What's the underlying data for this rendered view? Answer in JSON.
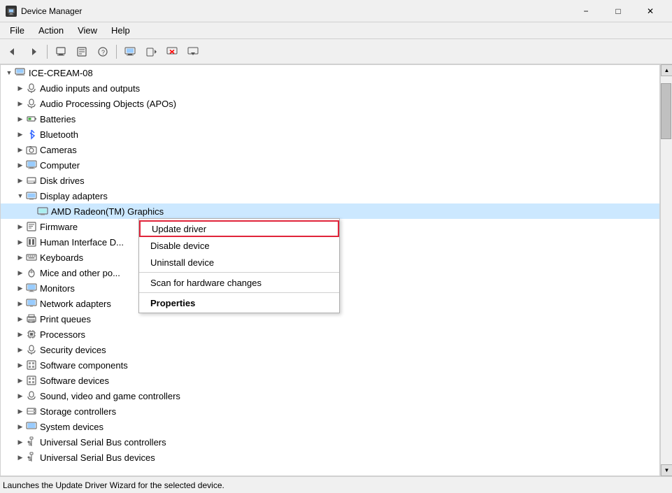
{
  "window": {
    "title": "Device Manager",
    "icon": "🖥",
    "minimize_label": "−",
    "maximize_label": "□",
    "close_label": "✕"
  },
  "menubar": {
    "items": [
      "File",
      "Action",
      "View",
      "Help"
    ]
  },
  "toolbar": {
    "buttons": [
      {
        "name": "back",
        "icon": "←"
      },
      {
        "name": "forward",
        "icon": "→"
      },
      {
        "name": "show-hidden",
        "icon": "📄"
      },
      {
        "name": "properties",
        "icon": "📋"
      },
      {
        "name": "help",
        "icon": "?"
      },
      {
        "name": "sep1",
        "sep": true
      },
      {
        "name": "scan",
        "icon": "🖥"
      },
      {
        "name": "scan2",
        "icon": "📸"
      },
      {
        "name": "remove",
        "icon": "✕"
      },
      {
        "name": "update",
        "icon": "↓"
      }
    ]
  },
  "tree": {
    "root": "ICE-CREAM-08",
    "items": [
      {
        "label": "ICE-CREAM-08",
        "indent": 0,
        "expanded": true,
        "icon": "computer",
        "level": "root"
      },
      {
        "label": "Audio inputs and outputs",
        "indent": 1,
        "expanded": false,
        "icon": "audio"
      },
      {
        "label": "Audio Processing Objects (APOs)",
        "indent": 1,
        "expanded": false,
        "icon": "audio"
      },
      {
        "label": "Batteries",
        "indent": 1,
        "expanded": false,
        "icon": "battery"
      },
      {
        "label": "Bluetooth",
        "indent": 1,
        "expanded": false,
        "icon": "bluetooth"
      },
      {
        "label": "Cameras",
        "indent": 1,
        "expanded": false,
        "icon": "camera"
      },
      {
        "label": "Computer",
        "indent": 1,
        "expanded": false,
        "icon": "computer2"
      },
      {
        "label": "Disk drives",
        "indent": 1,
        "expanded": false,
        "icon": "disk"
      },
      {
        "label": "Display adapters",
        "indent": 1,
        "expanded": true,
        "icon": "display"
      },
      {
        "label": "AMD Radeon(TM) Graphics",
        "indent": 2,
        "expanded": false,
        "icon": "display2",
        "selected": true
      },
      {
        "label": "Firmware",
        "indent": 1,
        "expanded": false,
        "icon": "firmware"
      },
      {
        "label": "Human Interface D...",
        "indent": 1,
        "expanded": false,
        "icon": "hid"
      },
      {
        "label": "Keyboards",
        "indent": 1,
        "expanded": false,
        "icon": "keyboard"
      },
      {
        "label": "Mice and other po...",
        "indent": 1,
        "expanded": false,
        "icon": "mouse"
      },
      {
        "label": "Monitors",
        "indent": 1,
        "expanded": false,
        "icon": "monitor"
      },
      {
        "label": "Network adapters",
        "indent": 1,
        "expanded": false,
        "icon": "network"
      },
      {
        "label": "Print queues",
        "indent": 1,
        "expanded": false,
        "icon": "printer"
      },
      {
        "label": "Processors",
        "indent": 1,
        "expanded": false,
        "icon": "processor"
      },
      {
        "label": "Security devices",
        "indent": 1,
        "expanded": false,
        "icon": "security"
      },
      {
        "label": "Software components",
        "indent": 1,
        "expanded": false,
        "icon": "software"
      },
      {
        "label": "Software devices",
        "indent": 1,
        "expanded": false,
        "icon": "software2"
      },
      {
        "label": "Sound, video and game controllers",
        "indent": 1,
        "expanded": false,
        "icon": "sound"
      },
      {
        "label": "Storage controllers",
        "indent": 1,
        "expanded": false,
        "icon": "storage"
      },
      {
        "label": "System devices",
        "indent": 1,
        "expanded": false,
        "icon": "system"
      },
      {
        "label": "Universal Serial Bus controllers",
        "indent": 1,
        "expanded": false,
        "icon": "usb"
      },
      {
        "label": "Universal Serial Bus devices",
        "indent": 1,
        "expanded": false,
        "icon": "usb2"
      }
    ]
  },
  "context_menu": {
    "items": [
      {
        "label": "Update driver",
        "type": "highlighted"
      },
      {
        "label": "Disable device",
        "type": "normal"
      },
      {
        "label": "Uninstall device",
        "type": "normal"
      },
      {
        "label": "---",
        "type": "separator"
      },
      {
        "label": "Scan for hardware changes",
        "type": "normal"
      },
      {
        "label": "---",
        "type": "separator"
      },
      {
        "label": "Properties",
        "type": "bold"
      }
    ]
  },
  "status_bar": {
    "text": "Launches the Update Driver Wizard for the selected device."
  }
}
